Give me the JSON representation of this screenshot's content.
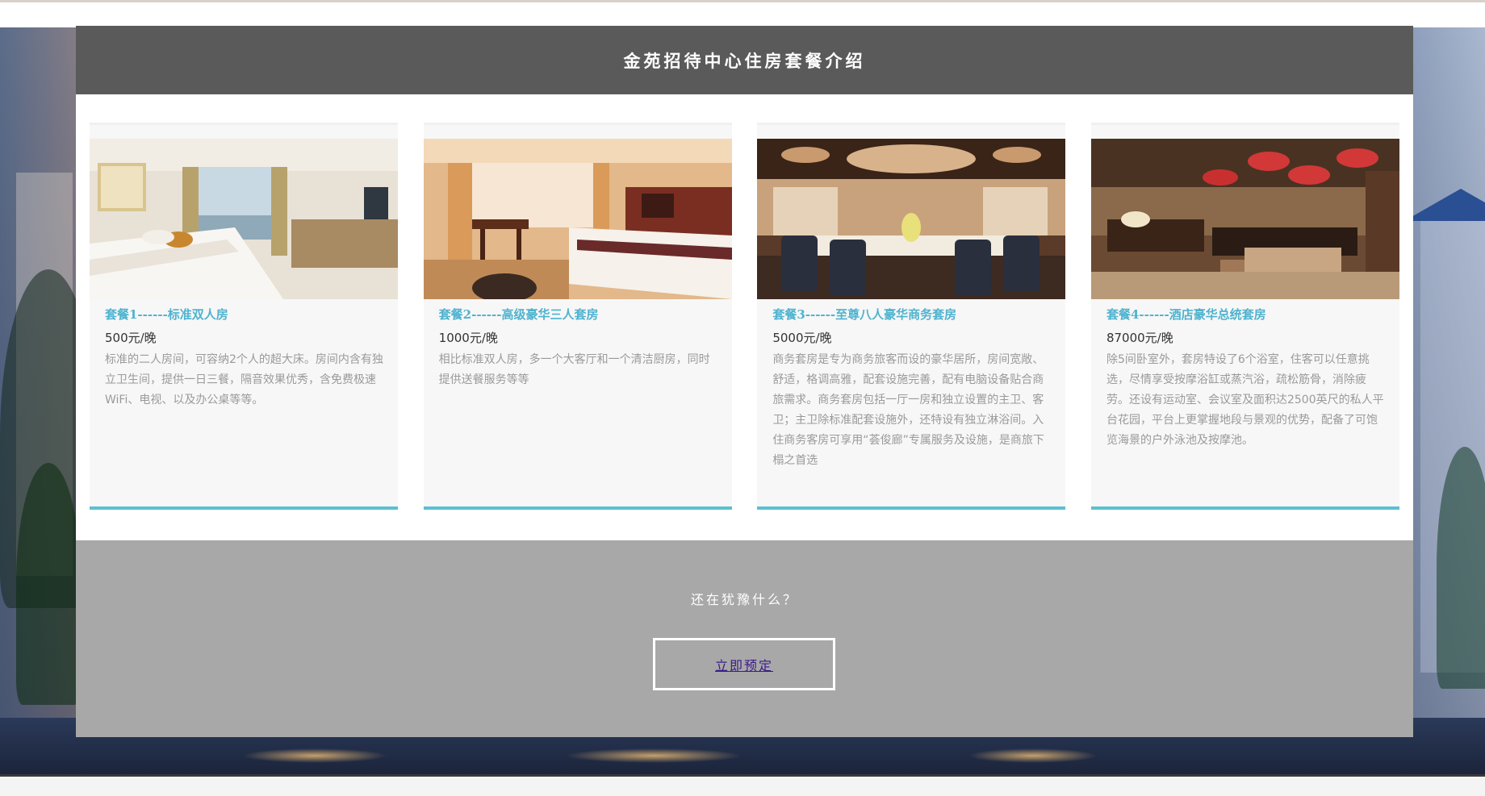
{
  "page": {
    "title": "金苑招待中心住房套餐介绍"
  },
  "packages": [
    {
      "title": "套餐1------标准双人房",
      "price": "500元/晚",
      "description": "标准的二人房间，可容纳2个人的超大床。房间内含有独立卫生间，提供一日三餐，隔音效果优秀，含免费极速WiFi、电视、以及办公桌等等。"
    },
    {
      "title": "套餐2------高级豪华三人套房",
      "price": "1000元/晚",
      "description": "相比标准双人房，多一个大客厅和一个清洁厨房，同时提供送餐服务等等"
    },
    {
      "title": "套餐3------至尊八人豪华商务套房",
      "price": "5000元/晚",
      "description": "商务套房是专为商务旅客而设的豪华居所，房间宽敞、舒适，格调高雅，配套设施完善，配有电脑设备贴合商旅需求。商务套房包括一厅一房和独立设置的主卫、客卫；主卫除标准配套设施外，还特设有独立淋浴间。入住商务客房可享用“荟俊廊”专属服务及设施，是商旅下榻之首选"
    },
    {
      "title": "套餐4------酒店豪华总统套房",
      "price": "87000元/晚",
      "description": "除5间卧室外，套房特设了6个浴室，住客可以任意挑选，尽情享受按摩浴缸或蒸汽浴，疏松筋骨，消除疲劳。还设有运动室、会议室及面积达2500英尺的私人平台花园，平台上更掌握地段与景观的优势，配备了可饱览海景的户外泳池及按摩池。"
    }
  ],
  "cta": {
    "question": "还在犹豫什么？",
    "button_label": "立即预定"
  },
  "colors": {
    "header_bg": "#5a5a5a",
    "accent": "#4fb3cf",
    "card_border": "#5bc0d0",
    "cta_bg": "#a8a8a8",
    "button_text": "#3a1a8a"
  }
}
